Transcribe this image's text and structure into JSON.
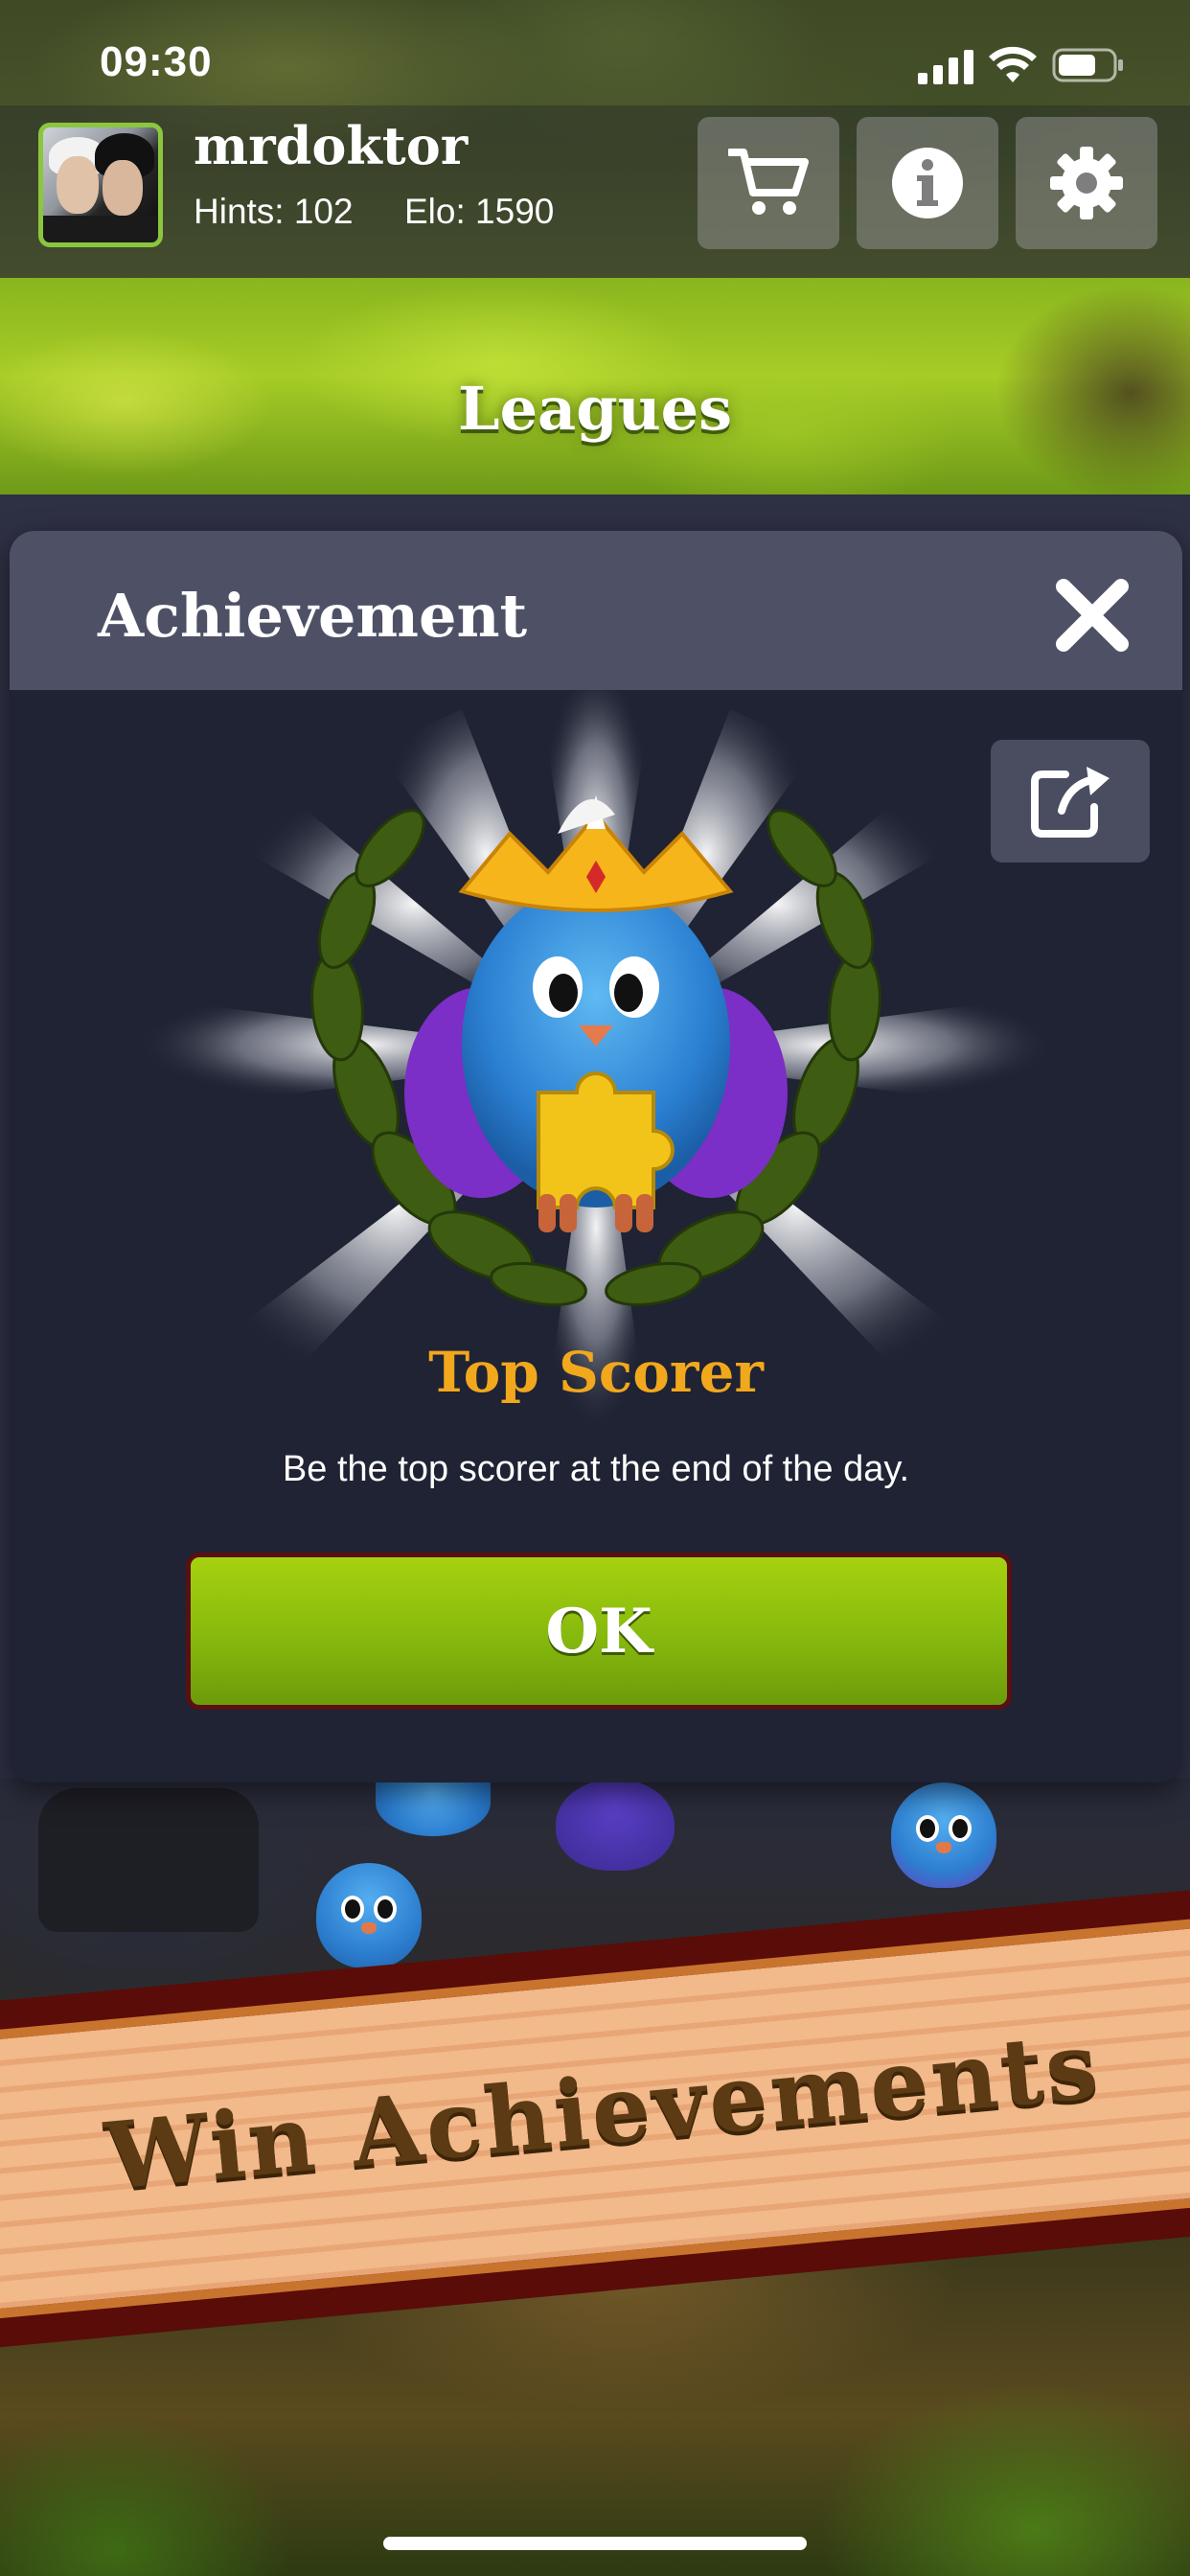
{
  "status_bar": {
    "time": "09:30"
  },
  "header": {
    "username": "mrdoktor",
    "hints": "Hints: 102",
    "elo": "Elo: 1590",
    "buttons": {
      "shop_icon": "cart-icon",
      "info_icon": "info-icon",
      "settings_icon": "gear-icon"
    }
  },
  "section": {
    "title": "Leagues"
  },
  "modal": {
    "title": "Achievement",
    "achievement_name": "Top Scorer",
    "achievement_description": "Be the top scorer at the end of the day.",
    "ok_label": "OK",
    "close_icon": "close-icon",
    "share_icon": "share-icon"
  },
  "promo_banner": {
    "text": "Win Achievements"
  },
  "colors": {
    "accent_green": "#8cc63f",
    "ok_button": "#86b90e",
    "achievement_title": "#f2a81d",
    "modal_bg": "#1f2333",
    "modal_header": "#4e5166"
  }
}
